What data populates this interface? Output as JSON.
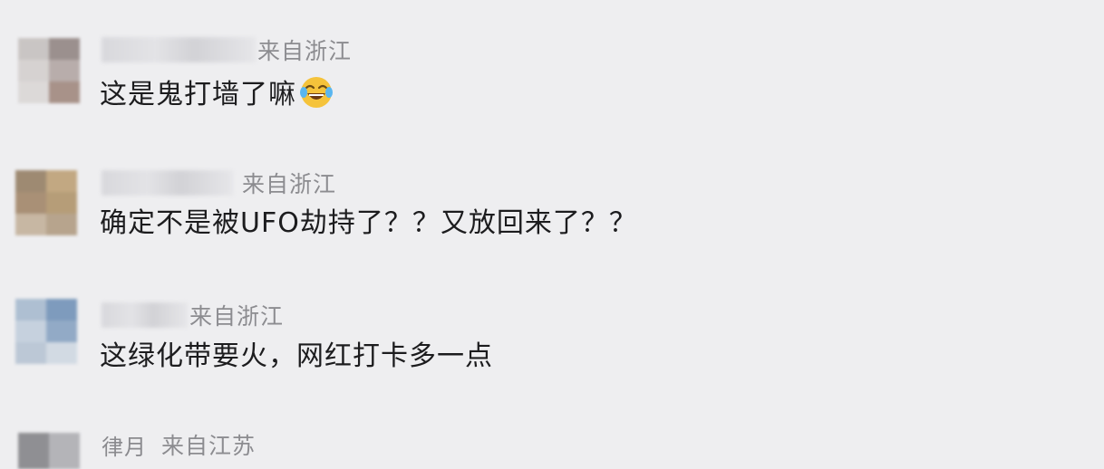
{
  "comments": [
    {
      "location": "来自浙江",
      "content": "这是鬼打墙了嘛",
      "emoji": "laughing-tears-emoji"
    },
    {
      "location": "来自浙江",
      "content": "确定不是被UFO劫持了？？又放回来了？？"
    },
    {
      "location": "来自浙江",
      "content": "这绿化带要火，网红打卡多一点"
    },
    {
      "username": "律月",
      "location": "来自江苏"
    }
  ],
  "colors": {
    "background": "#eeeef0",
    "text": "#1c1c1e",
    "meta": "#8c8c90"
  }
}
